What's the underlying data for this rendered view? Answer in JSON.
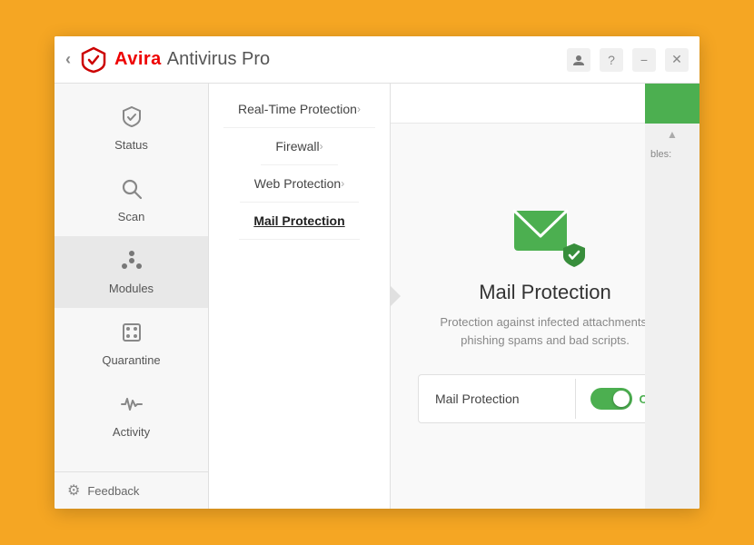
{
  "window": {
    "title": "Avira",
    "subtitle": "Antivirus Pro"
  },
  "titlebar": {
    "back_label": "‹",
    "logo_alt": "Avira Logo",
    "app_name": "Avira",
    "app_subtitle": "Antivirus Pro",
    "btn_user": "👤",
    "btn_help": "?",
    "btn_min": "−",
    "btn_close": "✕"
  },
  "sidebar": {
    "items": [
      {
        "id": "status",
        "label": "Status",
        "icon": "✓"
      },
      {
        "id": "scan",
        "label": "Scan",
        "icon": "🔍"
      },
      {
        "id": "modules",
        "label": "Modules",
        "icon": "❖"
      },
      {
        "id": "quarantine",
        "label": "Quarantine",
        "icon": "⊡"
      },
      {
        "id": "activity",
        "label": "Activity",
        "icon": "〰"
      }
    ],
    "footer": {
      "gear_icon": "⚙",
      "label": "Feedback"
    }
  },
  "menu": {
    "items": [
      {
        "id": "realtime",
        "label": "Real-Time Protection",
        "active": false
      },
      {
        "id": "firewall",
        "label": "Firewall",
        "active": false
      },
      {
        "id": "web",
        "label": "Web Protection",
        "active": false
      },
      {
        "id": "mail",
        "label": "Mail Protection",
        "active": true
      }
    ]
  },
  "content": {
    "gear_icon": "⚙",
    "feature_title": "Mail Protection",
    "feature_desc": "Protection against infected attachments, phishing spams and bad scripts.",
    "toggle": {
      "label": "Mail Protection",
      "state": "ON",
      "enabled": true
    },
    "scroll_label": "bles:"
  },
  "colors": {
    "green": "#4CAF50",
    "red": "#CC0000",
    "brand": "#CC0000"
  }
}
